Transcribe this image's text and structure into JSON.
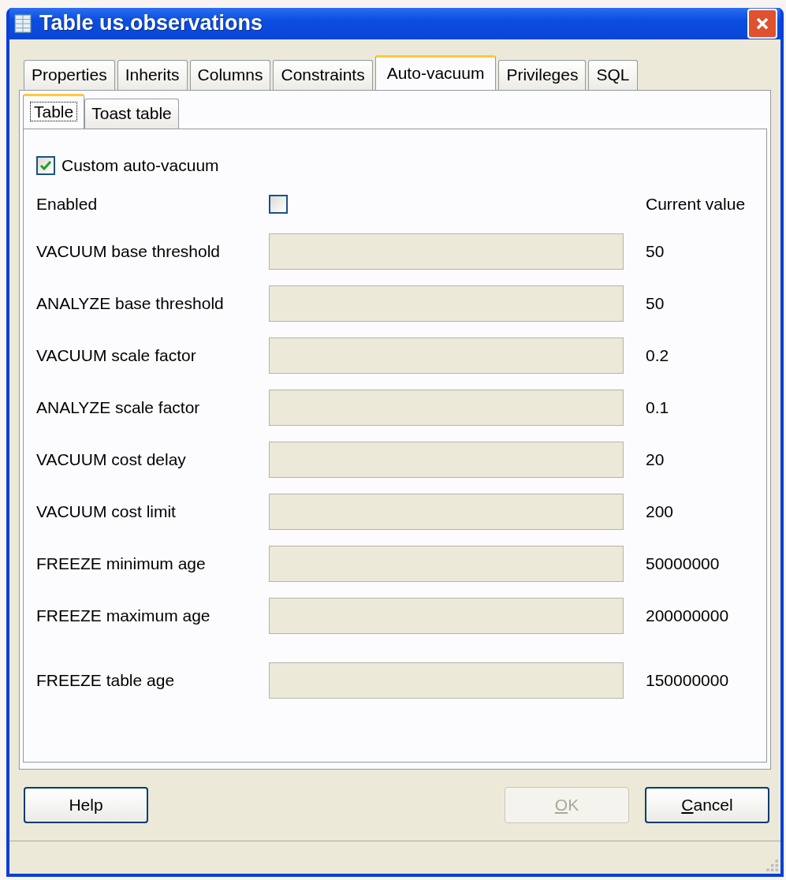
{
  "window": {
    "title": "Table us.observations"
  },
  "tabs": [
    {
      "label": "Properties",
      "selected": false
    },
    {
      "label": "Inherits",
      "selected": false
    },
    {
      "label": "Columns",
      "selected": false
    },
    {
      "label": "Constraints",
      "selected": false
    },
    {
      "label": "Auto-vacuum",
      "selected": true
    },
    {
      "label": "Privileges",
      "selected": false
    },
    {
      "label": "SQL",
      "selected": false
    }
  ],
  "subtabs": [
    {
      "label": "Table",
      "selected": true
    },
    {
      "label": "Toast table",
      "selected": false
    }
  ],
  "custom": {
    "label": "Custom auto-vacuum",
    "checked": true
  },
  "enabled": {
    "label": "Enabled",
    "checked": false
  },
  "current_heading": "Current value",
  "settings": [
    {
      "label": "VACUUM base threshold",
      "disabled": true,
      "current": "50"
    },
    {
      "label": "ANALYZE base threshold",
      "disabled": true,
      "current": "50"
    },
    {
      "label": "VACUUM scale factor",
      "disabled": true,
      "current": "0.2"
    },
    {
      "label": "ANALYZE scale factor",
      "disabled": true,
      "current": "0.1"
    },
    {
      "label": "VACUUM cost delay",
      "disabled": true,
      "current": "20"
    },
    {
      "label": "VACUUM cost limit",
      "disabled": true,
      "current": "200"
    },
    {
      "label": "FREEZE minimum age",
      "disabled": true,
      "current": "50000000"
    },
    {
      "label": "FREEZE maximum age",
      "disabled": true,
      "current": "200000000"
    },
    {
      "label": "FREEZE table age",
      "disabled": true,
      "current": "150000000"
    }
  ],
  "buttons": [
    {
      "kind": "help",
      "rest": "Help",
      "disabled": false
    },
    {
      "kind": "ok",
      "mnemonic": "O",
      "rest": "K",
      "disabled": true
    },
    {
      "kind": "cancel",
      "mnemonic": "C",
      "rest": "ancel",
      "disabled": false
    }
  ]
}
